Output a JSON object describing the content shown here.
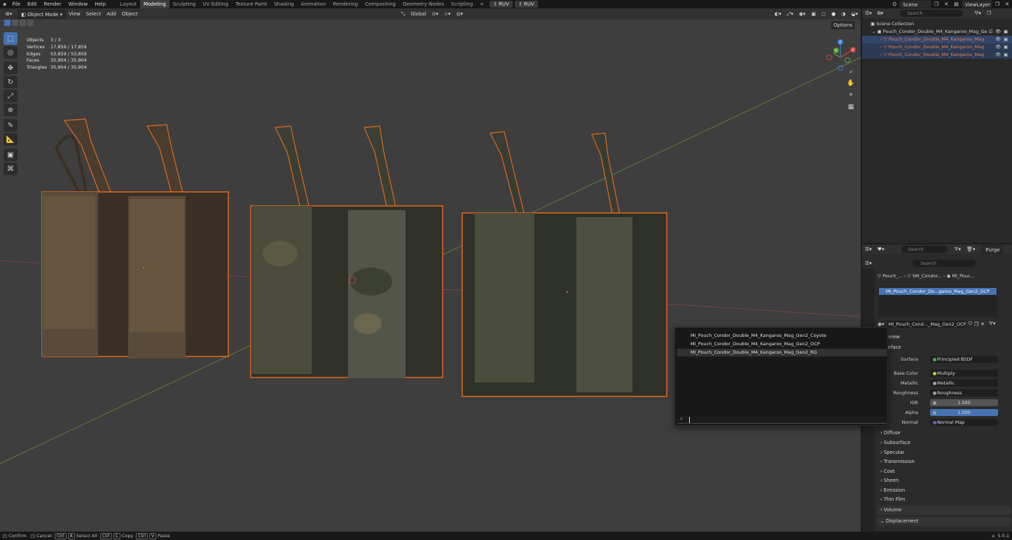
{
  "topbar": {
    "menus": [
      "File",
      "Edit",
      "Render",
      "Window",
      "Help"
    ],
    "workspaces": [
      "Layout",
      "Modeling",
      "Sculpting",
      "UV Editing",
      "Texture Paint",
      "Shading",
      "Animation",
      "Rendering",
      "Compositing",
      "Geometry Nodes",
      "Scripting"
    ],
    "active_workspace": "Modeling",
    "add_tab": "+",
    "ruv1": "RUV",
    "ruv2": "RUV",
    "scene": "Scene",
    "view_layer": "ViewLayer"
  },
  "viewport": {
    "mode": "Object Mode",
    "menus": [
      "View",
      "Select",
      "Add",
      "Object"
    ],
    "orientation": "Global",
    "options": "Options",
    "stats": [
      {
        "label": "Objects",
        "value": "3 / 3"
      },
      {
        "label": "Vertices",
        "value": "17,859 / 17,859"
      },
      {
        "label": "Edges",
        "value": "53,859 / 53,859"
      },
      {
        "label": "Faces",
        "value": "35,904 / 35,904"
      },
      {
        "label": "Triangles",
        "value": "35,904 / 35,904"
      }
    ],
    "pouch_colors": [
      "#5a4a3a",
      "#4b4c3c",
      "#4a4d3c"
    ],
    "selection_outline": "#e06a1e"
  },
  "outliner": {
    "search_placeholder": "Search",
    "scene_collection": "Scene Collection",
    "parent": "Pouch_Condor_Double_M4_Kangaroo_Mag_Ge",
    "children": [
      "Pouch_Condor_Double_M4_Kangaroo_Mag",
      "Pouch_Condor_Double_M4_Kangaroo_Mag",
      "Pouch_Condor_Double_M4_Kangaroo_Mag"
    ]
  },
  "props_header": {
    "search_placeholder": "Search",
    "purge": "Purge"
  },
  "properties": {
    "search_placeholder": "Search",
    "breadcrumb": [
      "Pouch_...",
      "SM_Condor...",
      "MI_Pouc..."
    ],
    "material_slot": "MI_Pouch_Condor_Do...garoo_Mag_Gen2_OCP",
    "material_name": "MI_Pouch_Cond..._Mag_Gen2_OCP",
    "preview": "eview",
    "surface_section": "urface",
    "rows": [
      {
        "label": "Surface",
        "value": "Principled BSDF",
        "dot": "#4caf50"
      },
      {
        "label": "Base Color",
        "value": "Multiply",
        "dot": "#c8c83c"
      },
      {
        "label": "Metallic",
        "value": "Metallic",
        "dot": "#a0a0a0"
      },
      {
        "label": "Roughness",
        "value": "Roughness",
        "dot": "#a0a0a0"
      },
      {
        "label": "IOR",
        "value": "1.500",
        "dot": "#a0a0a0"
      },
      {
        "label": "Alpha",
        "value": "1.000",
        "dot": "#a0a0a0"
      },
      {
        "label": "Normal",
        "value": "Normal Map",
        "dot": "#6464c8"
      }
    ],
    "sections": [
      "Diffuse",
      "Subsurface",
      "Specular",
      "Transmission",
      "Coat",
      "Sheen",
      "Emission",
      "Thin Film"
    ],
    "volume": "Volume",
    "displacement": "Displacement"
  },
  "dropdown": {
    "items": [
      "MI_Pouch_Condor_Double_M4_Kangaroo_Mag_Gen2_Coyote",
      "MI_Pouch_Condor_Double_M4_Kangaroo_Mag_Gen2_OCP",
      "MI_Pouch_Condor_Double_M4_Kangaroo_Mag_Gen2_RG"
    ],
    "highlighted_index": 2
  },
  "statusbar": {
    "confirm": "Confirm",
    "cancel": "Cancel",
    "ctrl": "Ctrl",
    "a": "A",
    "select_all": "Select All",
    "c": "C",
    "copy": "Copy",
    "v": "V",
    "paste": "Paste",
    "version": "5.0.1"
  }
}
